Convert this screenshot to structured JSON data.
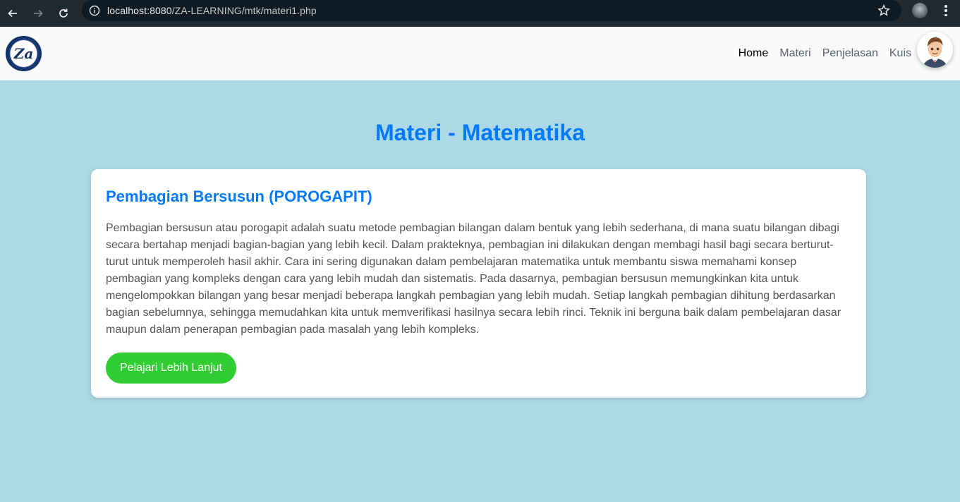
{
  "browser": {
    "url_host": "localhost:8080",
    "url_path": "/ZA-LEARNING/mtk/materi1.php",
    "icons": [
      "back-icon",
      "forward-icon",
      "reload-icon",
      "info-icon",
      "star-icon",
      "kebab-menu-icon"
    ]
  },
  "navbar": {
    "logo_text": "Za",
    "items": [
      {
        "label": "Home",
        "active": true
      },
      {
        "label": "Materi",
        "active": false
      },
      {
        "label": "Penjelasan",
        "active": false
      },
      {
        "label": "Kuis",
        "active": false
      }
    ]
  },
  "main": {
    "title": "Materi - Matematika",
    "card": {
      "title": "Pembagian Bersusun (POROGAPIT)",
      "body": "Pembagian bersusun atau porogapit adalah suatu metode pembagian bilangan dalam bentuk yang lebih sederhana, di mana suatu bilangan dibagi secara bertahap menjadi bagian-bagian yang lebih kecil. Dalam prakteknya, pembagian ini dilakukan dengan membagi hasil bagi secara berturut-turut untuk memperoleh hasil akhir. Cara ini sering digunakan dalam pembelajaran matematika untuk membantu siswa memahami konsep pembagian yang kompleks dengan cara yang lebih mudah dan sistematis. Pada dasarnya, pembagian bersusun memungkinkan kita untuk mengelompokkan bilangan yang besar menjadi beberapa langkah pembagian yang lebih mudah. Setiap langkah pembagian dihitung berdasarkan bagian sebelumnya, sehingga memudahkan kita untuk memverifikasi hasilnya secara lebih rinci. Teknik ini berguna baik dalam pembelajaran dasar maupun dalam penerapan pembagian pada masalah yang lebih kompleks.",
      "button_label": "Pelajari Lebih Lanjut"
    }
  },
  "colors": {
    "page_bg": "#add8e6",
    "title": "#007bff",
    "button": "#32cd32",
    "navbar_bg": "#f8f9fa"
  }
}
